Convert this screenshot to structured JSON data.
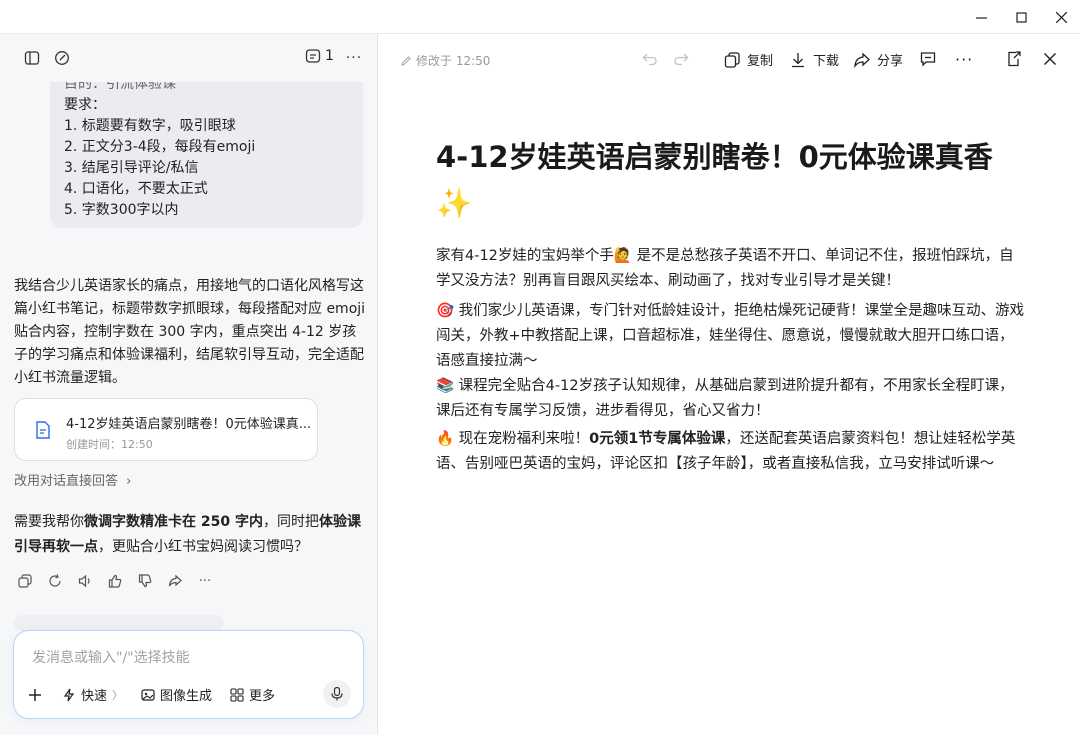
{
  "window": {
    "controls": [
      "minimize",
      "maximize",
      "close"
    ]
  },
  "sidebar": {
    "message_count": "1",
    "user_message": {
      "partial_line": "目的：引流体验课",
      "lines": [
        "要求：",
        "1. 标题要有数字，吸引眼球",
        "2. 正文分3-4段，每段有emoji",
        "3. 结尾引导评论/私信",
        "4. 口语化，不要太正式",
        "5. 字数300字以内"
      ]
    },
    "reply": "我结合少儿英语家长的痛点，用接地气的口语化风格写这篇小红书笔记，标题带数字抓眼球，每段搭配对应 emoji 贴合内容，控制字数在 300 字内，重点突出 4-12 岁孩子的学习痛点和体验课福利，结尾软引导互动，完全适配小红书流量逻辑。",
    "doc_card": {
      "title": "4-12岁娃英语启蒙别瞎卷！0元体验课真...",
      "created": "创建时间：12:50"
    },
    "alt_answer": "改用对话直接回答",
    "followup": {
      "pre": "需要我帮你",
      "bold1": "微调字数精准卡在 250 字内",
      "mid": "，同时把",
      "bold2": "体验课引导再软一点",
      "post": "，更贴合小红书宝妈阅读习惯吗？"
    },
    "input": {
      "placeholder": "发消息或输入\"/\"选择技能",
      "tools": [
        "快速",
        "图像生成",
        "更多"
      ]
    }
  },
  "toolbar": {
    "edited": "修改于 12:50",
    "copy": "复制",
    "download": "下载",
    "share": "分享"
  },
  "document": {
    "title": "4-12岁娃英语启蒙别瞎卷！0元体验课真香",
    "title_emoji": "✨",
    "p1": "家有4-12岁娃的宝妈举个手🙋 是不是总愁孩子英语不开口、单词记不住，报班怕踩坑，自学又没方法？别再盲目跟风买绘本、刷动画了，找对专业引导才是关键！",
    "p2": "🎯 我们家少儿英语课，专门针对低龄娃设计，拒绝枯燥死记硬背！课堂全是趣味互动、游戏闯关，外教+中教搭配上课，口音超标准，娃坐得住、愿意说，慢慢就敢大胆开口练口语，语感直接拉满～",
    "p3": "📚 课程完全贴合4-12岁孩子认知规律，从基础启蒙到进阶提升都有，不用家长全程盯课，课后还有专属学习反馈，进步看得见，省心又省力！",
    "p4_pre": "🔥 现在宠粉福利来啦！",
    "p4_bold": "0元领1节专属体验课",
    "p4_post": "，还送配套英语启蒙资料包！想让娃轻松学英语、告别哑巴英语的宝妈，评论区扣【孩子年龄】，或者直接私信我，立马安排试听课～"
  }
}
